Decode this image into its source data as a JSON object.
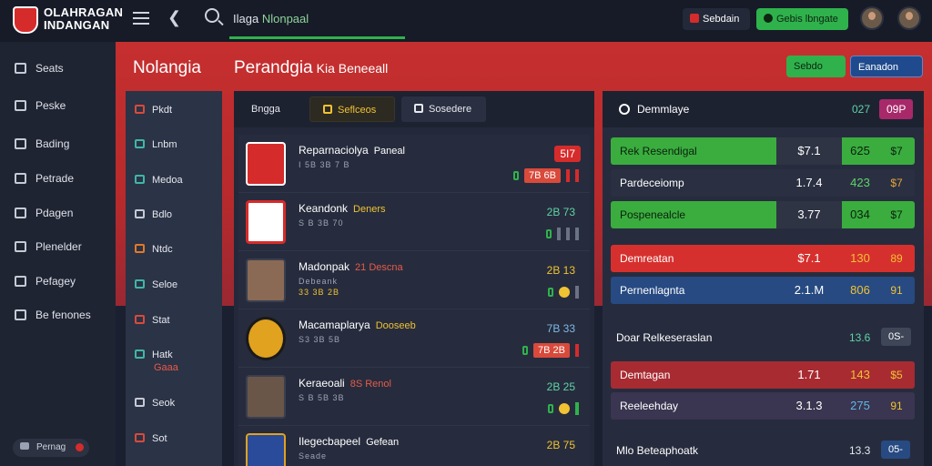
{
  "app": {
    "logo_line1": "OLAHRAGAN",
    "logo_line2": "INDANGAN"
  },
  "search": {
    "text_prefix": "Ilaga",
    "text_highlight": "Nlonpaal"
  },
  "topbar": {
    "btn1": "Sebdain",
    "btn2": "Gebis lbngate"
  },
  "sidebar": {
    "items": [
      "Seats",
      "Peske",
      "Bading",
      "Petrade",
      "Pdagen",
      "Plenelder",
      "Pefagey",
      "Be fenones"
    ],
    "footer": "Pernag"
  },
  "header": {
    "title1": "Nolangia",
    "title2": "Perandgia",
    "title2_small": "Kia Beneeall",
    "btn_green": "Sebdo",
    "btn_blue": "Eanadon"
  },
  "categories": [
    {
      "label": "Pkdt",
      "icon": "trophy-icon",
      "sub": ""
    },
    {
      "label": "Lnbm",
      "icon": "calendar-icon",
      "sub": ""
    },
    {
      "label": "Medoa",
      "icon": "search-icon",
      "sub": ""
    },
    {
      "label": "Bdlo",
      "icon": "camera-icon",
      "sub": ""
    },
    {
      "label": "Ntdc",
      "icon": "box-icon",
      "sub": ""
    },
    {
      "label": "Seloe",
      "icon": "screen-icon",
      "sub": ""
    },
    {
      "label": "Stat",
      "icon": "ball-icon",
      "sub": ""
    },
    {
      "label": "Hatk",
      "icon": "image-icon",
      "sub": "Gaaa"
    },
    {
      "label": "Seok",
      "icon": "clip-icon",
      "sub": ""
    },
    {
      "label": "Sot",
      "icon": "flame-icon",
      "sub": ""
    }
  ],
  "tabs": [
    "Bngga",
    "Seflceos",
    "Sosedere"
  ],
  "matches": [
    {
      "name": "Reparnaciolya",
      "tag": "Paneal",
      "meta1": "I 5B 3B 7 B",
      "meta2": "",
      "score": "5I7",
      "odd": "7B 6B"
    },
    {
      "name": "Keandonk",
      "tag": "Deners",
      "meta1": "S B 3B 70",
      "meta2": "",
      "score": "2B 73",
      "odd": ""
    },
    {
      "name": "Madonpak",
      "tag": "21 Descna",
      "meta1": "Debeank",
      "meta2": "33 3B 2B",
      "score": "2B 13",
      "odd": ""
    },
    {
      "name": "Macamaplarya",
      "tag": "Dooseeb",
      "meta1": "S3 3B 5B",
      "meta2": "",
      "score": "7B 33",
      "odd": "7B 2B"
    },
    {
      "name": "Keraeoali",
      "tag": "8S Renol",
      "meta1": "S B 5B 3B",
      "meta2": "",
      "score": "2B 25",
      "odd": ""
    },
    {
      "name": "Ilegecbapeel",
      "tag": "Gefean",
      "meta1": "Seade",
      "meta2": "",
      "score": "2B 75",
      "odd": ""
    }
  ],
  "odds": {
    "title": "Demmlaye",
    "head_v1": "027",
    "head_v2": "09P",
    "rows": [
      {
        "label": "Rek Resendigal",
        "v1": "$7.1",
        "v2": "625",
        "v3": "$7"
      },
      {
        "label": "Pardeceiomp",
        "v1": "1.7.4",
        "v2": "423",
        "v3": "$7"
      },
      {
        "label": "Pospenealcle",
        "v1": "3.77",
        "v2": "034",
        "v3": "$7"
      },
      {
        "label": "Demreatan",
        "v1": "$7.1",
        "v2": "130",
        "v3": "89"
      },
      {
        "label": "Pernenlagnta",
        "v1": "2.1.M",
        "v2": "806",
        "v3": "91"
      }
    ],
    "section2_title": "Doar Relkeseraslan",
    "section2_val": "13.6",
    "section2_pill": "0S-",
    "rows2": [
      {
        "label": "Demtagan",
        "v1": "1.71",
        "v2": "143",
        "v3": "$5"
      },
      {
        "label": "Reeleehday",
        "v1": "3.1.3",
        "v2": "275",
        "v3": "91"
      }
    ],
    "section3_title": "Mlo Beteaphoatk",
    "section3_val": "13.3",
    "section3_pill": "05-"
  }
}
